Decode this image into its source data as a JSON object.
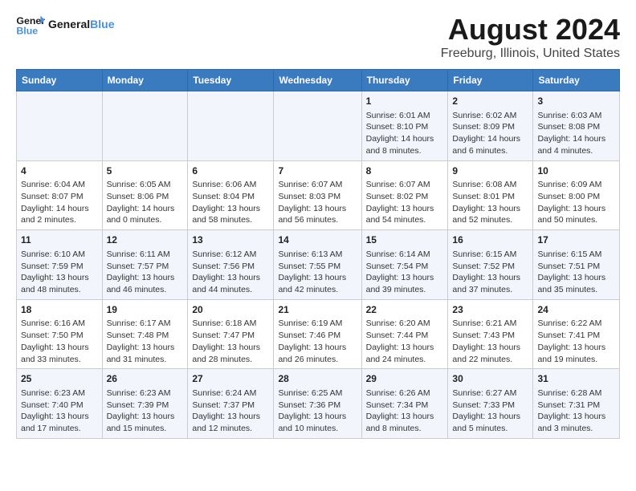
{
  "header": {
    "logo_text_general": "General",
    "logo_text_blue": "Blue",
    "title": "August 2024",
    "subtitle": "Freeburg, Illinois, United States"
  },
  "weekdays": [
    "Sunday",
    "Monday",
    "Tuesday",
    "Wednesday",
    "Thursday",
    "Friday",
    "Saturday"
  ],
  "weeks": [
    [
      {
        "day": "",
        "info": ""
      },
      {
        "day": "",
        "info": ""
      },
      {
        "day": "",
        "info": ""
      },
      {
        "day": "",
        "info": ""
      },
      {
        "day": "1",
        "info": "Sunrise: 6:01 AM\nSunset: 8:10 PM\nDaylight: 14 hours\nand 8 minutes."
      },
      {
        "day": "2",
        "info": "Sunrise: 6:02 AM\nSunset: 8:09 PM\nDaylight: 14 hours\nand 6 minutes."
      },
      {
        "day": "3",
        "info": "Sunrise: 6:03 AM\nSunset: 8:08 PM\nDaylight: 14 hours\nand 4 minutes."
      }
    ],
    [
      {
        "day": "4",
        "info": "Sunrise: 6:04 AM\nSunset: 8:07 PM\nDaylight: 14 hours\nand 2 minutes."
      },
      {
        "day": "5",
        "info": "Sunrise: 6:05 AM\nSunset: 8:06 PM\nDaylight: 14 hours\nand 0 minutes."
      },
      {
        "day": "6",
        "info": "Sunrise: 6:06 AM\nSunset: 8:04 PM\nDaylight: 13 hours\nand 58 minutes."
      },
      {
        "day": "7",
        "info": "Sunrise: 6:07 AM\nSunset: 8:03 PM\nDaylight: 13 hours\nand 56 minutes."
      },
      {
        "day": "8",
        "info": "Sunrise: 6:07 AM\nSunset: 8:02 PM\nDaylight: 13 hours\nand 54 minutes."
      },
      {
        "day": "9",
        "info": "Sunrise: 6:08 AM\nSunset: 8:01 PM\nDaylight: 13 hours\nand 52 minutes."
      },
      {
        "day": "10",
        "info": "Sunrise: 6:09 AM\nSunset: 8:00 PM\nDaylight: 13 hours\nand 50 minutes."
      }
    ],
    [
      {
        "day": "11",
        "info": "Sunrise: 6:10 AM\nSunset: 7:59 PM\nDaylight: 13 hours\nand 48 minutes."
      },
      {
        "day": "12",
        "info": "Sunrise: 6:11 AM\nSunset: 7:57 PM\nDaylight: 13 hours\nand 46 minutes."
      },
      {
        "day": "13",
        "info": "Sunrise: 6:12 AM\nSunset: 7:56 PM\nDaylight: 13 hours\nand 44 minutes."
      },
      {
        "day": "14",
        "info": "Sunrise: 6:13 AM\nSunset: 7:55 PM\nDaylight: 13 hours\nand 42 minutes."
      },
      {
        "day": "15",
        "info": "Sunrise: 6:14 AM\nSunset: 7:54 PM\nDaylight: 13 hours\nand 39 minutes."
      },
      {
        "day": "16",
        "info": "Sunrise: 6:15 AM\nSunset: 7:52 PM\nDaylight: 13 hours\nand 37 minutes."
      },
      {
        "day": "17",
        "info": "Sunrise: 6:15 AM\nSunset: 7:51 PM\nDaylight: 13 hours\nand 35 minutes."
      }
    ],
    [
      {
        "day": "18",
        "info": "Sunrise: 6:16 AM\nSunset: 7:50 PM\nDaylight: 13 hours\nand 33 minutes."
      },
      {
        "day": "19",
        "info": "Sunrise: 6:17 AM\nSunset: 7:48 PM\nDaylight: 13 hours\nand 31 minutes."
      },
      {
        "day": "20",
        "info": "Sunrise: 6:18 AM\nSunset: 7:47 PM\nDaylight: 13 hours\nand 28 minutes."
      },
      {
        "day": "21",
        "info": "Sunrise: 6:19 AM\nSunset: 7:46 PM\nDaylight: 13 hours\nand 26 minutes."
      },
      {
        "day": "22",
        "info": "Sunrise: 6:20 AM\nSunset: 7:44 PM\nDaylight: 13 hours\nand 24 minutes."
      },
      {
        "day": "23",
        "info": "Sunrise: 6:21 AM\nSunset: 7:43 PM\nDaylight: 13 hours\nand 22 minutes."
      },
      {
        "day": "24",
        "info": "Sunrise: 6:22 AM\nSunset: 7:41 PM\nDaylight: 13 hours\nand 19 minutes."
      }
    ],
    [
      {
        "day": "25",
        "info": "Sunrise: 6:23 AM\nSunset: 7:40 PM\nDaylight: 13 hours\nand 17 minutes."
      },
      {
        "day": "26",
        "info": "Sunrise: 6:23 AM\nSunset: 7:39 PM\nDaylight: 13 hours\nand 15 minutes."
      },
      {
        "day": "27",
        "info": "Sunrise: 6:24 AM\nSunset: 7:37 PM\nDaylight: 13 hours\nand 12 minutes."
      },
      {
        "day": "28",
        "info": "Sunrise: 6:25 AM\nSunset: 7:36 PM\nDaylight: 13 hours\nand 10 minutes."
      },
      {
        "day": "29",
        "info": "Sunrise: 6:26 AM\nSunset: 7:34 PM\nDaylight: 13 hours\nand 8 minutes."
      },
      {
        "day": "30",
        "info": "Sunrise: 6:27 AM\nSunset: 7:33 PM\nDaylight: 13 hours\nand 5 minutes."
      },
      {
        "day": "31",
        "info": "Sunrise: 6:28 AM\nSunset: 7:31 PM\nDaylight: 13 hours\nand 3 minutes."
      }
    ]
  ]
}
